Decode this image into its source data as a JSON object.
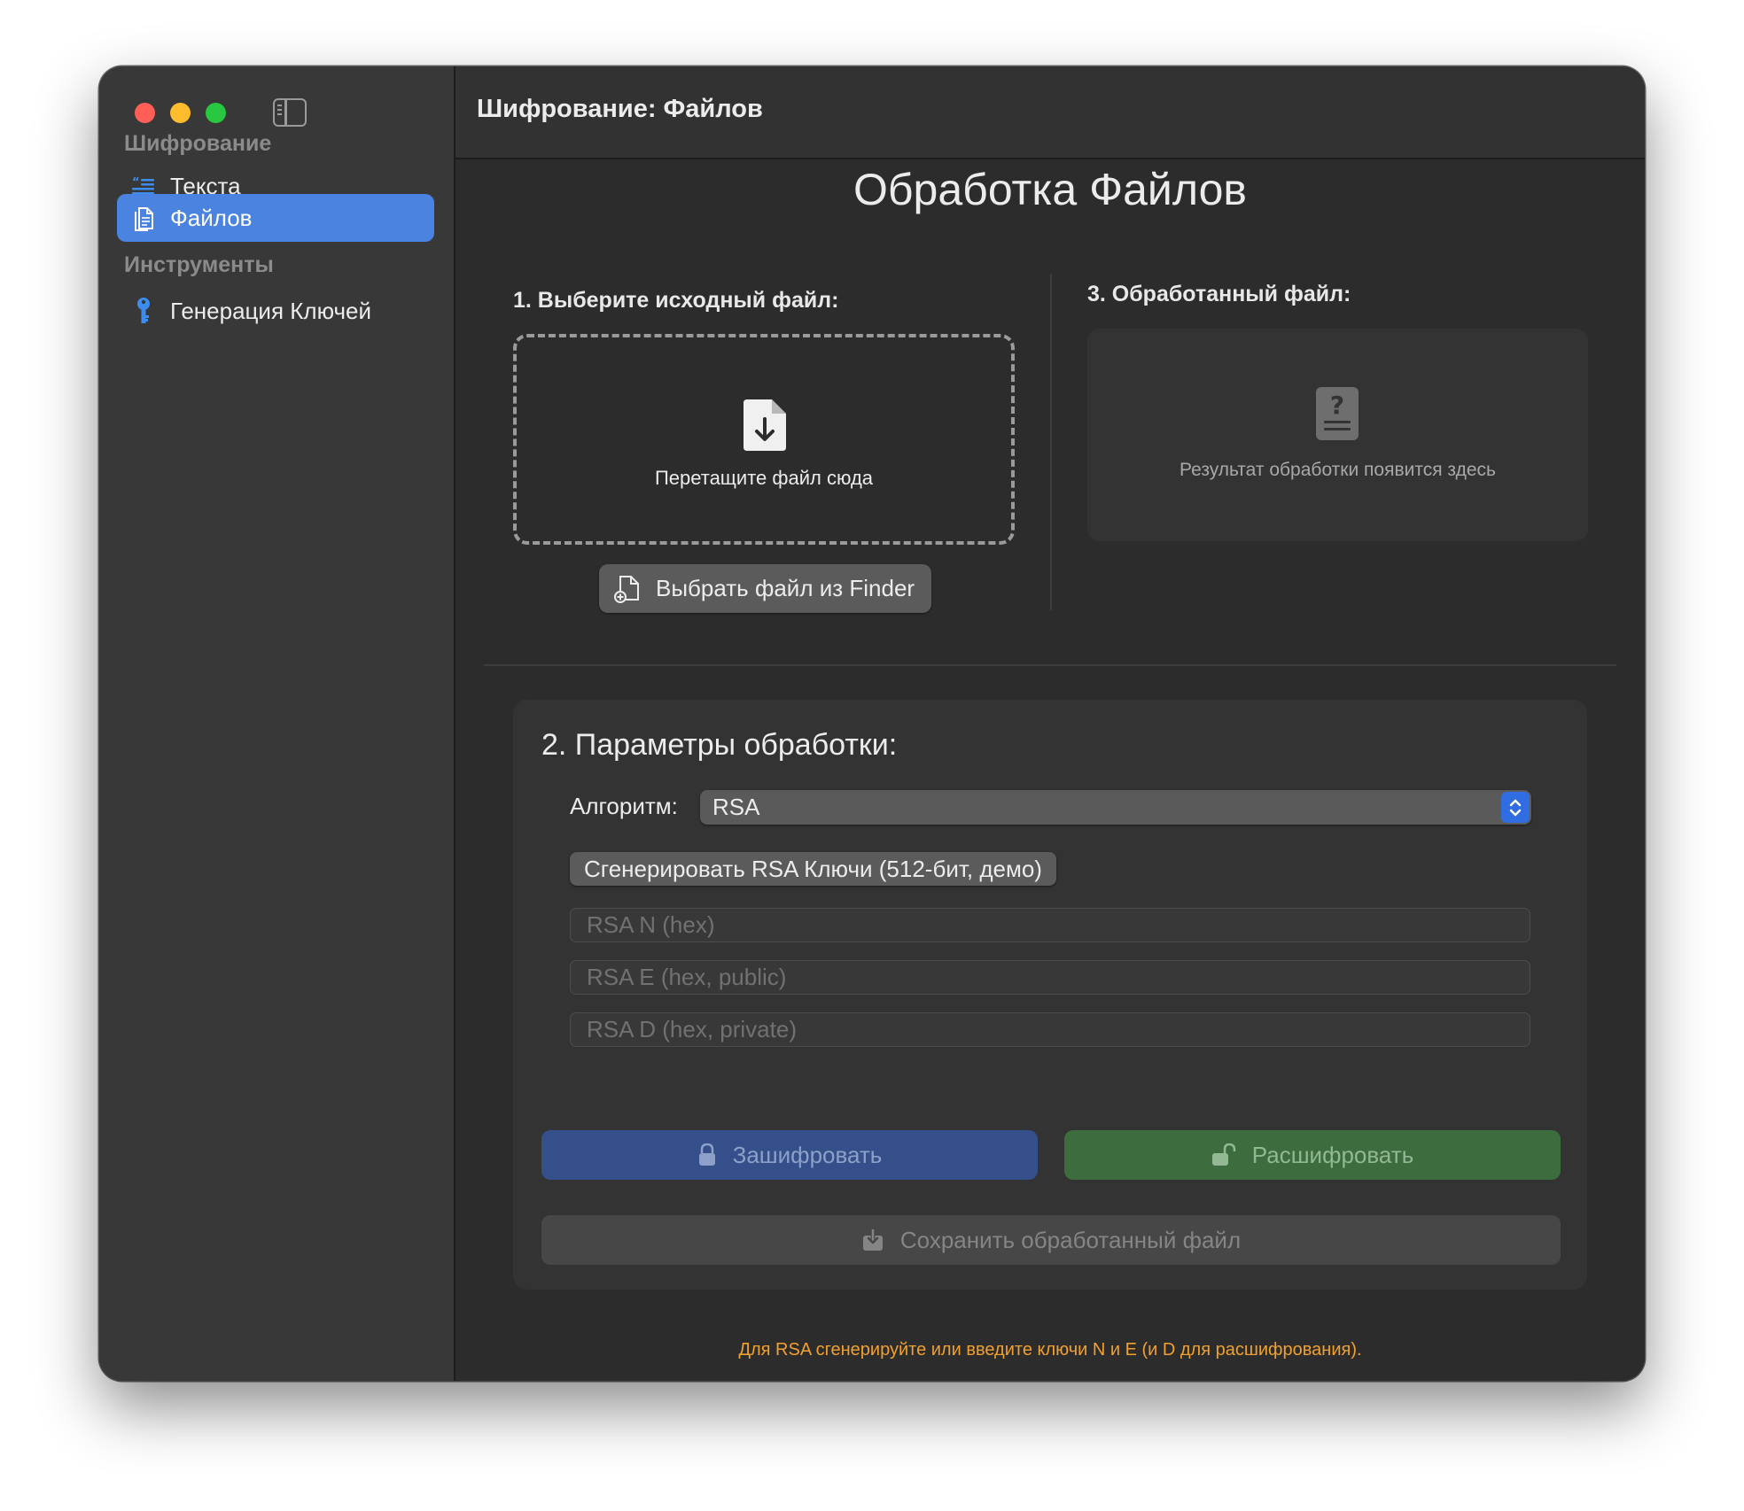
{
  "window": {
    "title": "Шифрование: Файлов"
  },
  "sidebar": {
    "sections": [
      {
        "title": "Шифрование",
        "items": [
          {
            "label": "Текста",
            "icon": "text-quote-icon",
            "active": false
          },
          {
            "label": "Файлов",
            "icon": "documents-icon",
            "active": true
          }
        ]
      },
      {
        "title": "Инструменты",
        "items": [
          {
            "label": "Генерация Ключей",
            "icon": "key-icon",
            "active": false
          }
        ]
      }
    ]
  },
  "main": {
    "page_title": "Обработка Файлов",
    "source": {
      "heading": "1. Выберите исходный файл:",
      "drop_text": "Перетащите файл сюда",
      "drop_icon": "doc-download-icon",
      "finder_button": "Выбрать файл из Finder"
    },
    "result": {
      "heading": "3. Обработанный файл:",
      "placeholder_text": "Результат обработки появится здесь",
      "icon": "doc-question-icon"
    },
    "params": {
      "title": "2. Параметры обработки:",
      "algorithm_label": "Алгоритм:",
      "algorithm_value": "RSA",
      "generate_button": "Сгенерировать RSA Ключи (512-бит, демо)",
      "fields": {
        "n_placeholder": "RSA N (hex)",
        "e_placeholder": "RSA E (hex, public)",
        "d_placeholder": "RSA D (hex, private)"
      },
      "encrypt_button": "Зашифровать",
      "decrypt_button": "Расшифровать",
      "save_button": "Сохранить обработанный файл"
    },
    "hint": "Для RSA сгенерируйте или введите ключи N и E (и D для расшифрования)."
  },
  "colors": {
    "accent": "#4a84e0",
    "encrypt": "#344f89",
    "decrypt": "#3d6c3e",
    "hint": "#f0a030"
  }
}
